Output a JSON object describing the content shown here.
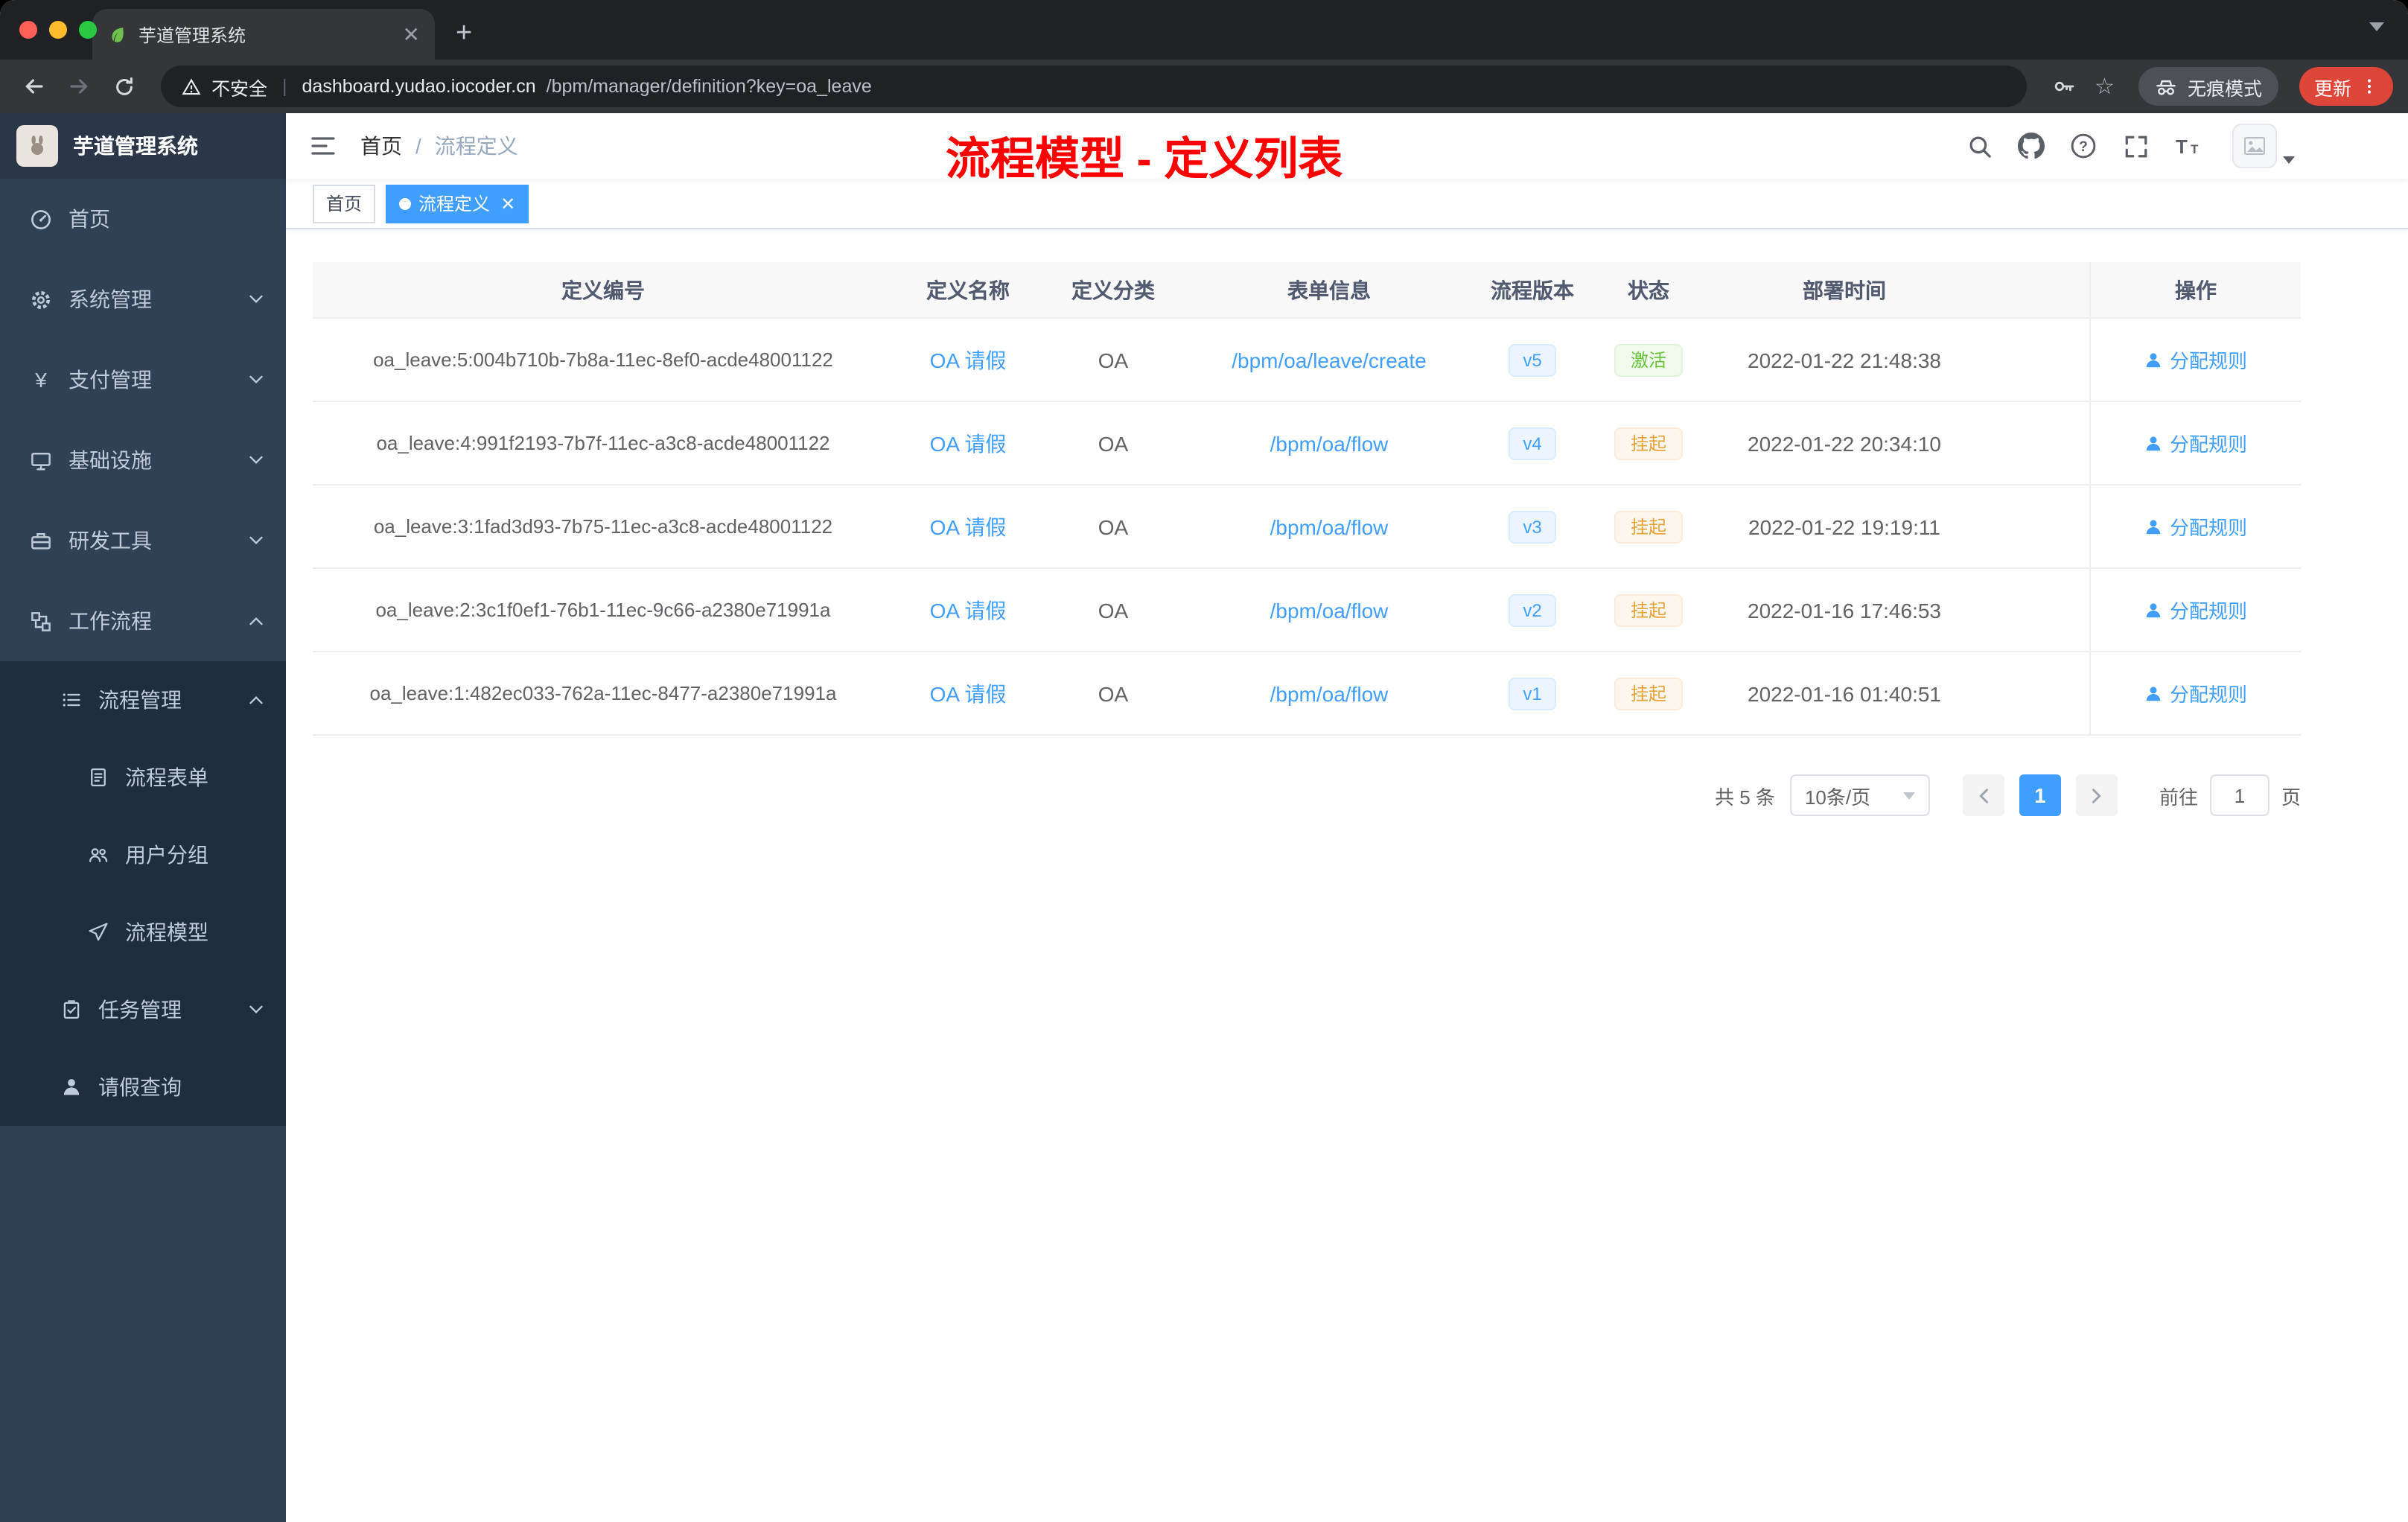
{
  "browser": {
    "tab_title": "芋道管理系统",
    "security_label": "不安全",
    "url_host": "dashboard.yudao.iocoder.cn",
    "url_path": "/bpm/manager/definition?key=oa_leave",
    "incognito_label": "无痕模式",
    "update_label": "更新"
  },
  "sidebar": {
    "logo_title": "芋道管理系统",
    "menu": [
      {
        "label": "首页"
      },
      {
        "label": "系统管理"
      },
      {
        "label": "支付管理"
      },
      {
        "label": "基础设施"
      },
      {
        "label": "研发工具"
      },
      {
        "label": "工作流程"
      }
    ],
    "submenu": [
      {
        "label": "流程管理"
      },
      {
        "label": "流程表单"
      },
      {
        "label": "用户分组"
      },
      {
        "label": "流程模型"
      },
      {
        "label": "任务管理"
      },
      {
        "label": "请假查询"
      }
    ]
  },
  "header": {
    "breadcrumb": [
      "首页",
      "流程定义"
    ],
    "breadcrumb_sep": "/",
    "annotation": "流程模型 - 定义列表"
  },
  "tags": [
    {
      "label": "首页",
      "active": false
    },
    {
      "label": "流程定义",
      "active": true
    }
  ],
  "table": {
    "headers": [
      "定义编号",
      "定义名称",
      "定义分类",
      "表单信息",
      "流程版本",
      "状态",
      "部署时间",
      "操作"
    ],
    "rows": [
      {
        "id": "oa_leave:5:004b710b-7b8a-11ec-8ef0-acde48001122",
        "name": "OA 请假",
        "category": "OA",
        "form": "/bpm/oa/leave/create",
        "version": "v5",
        "status": "激活",
        "status_type": "success",
        "time": "2022-01-22 21:48:38",
        "action": "分配规则"
      },
      {
        "id": "oa_leave:4:991f2193-7b7f-11ec-a3c8-acde48001122",
        "name": "OA 请假",
        "category": "OA",
        "form": "/bpm/oa/flow",
        "version": "v4",
        "status": "挂起",
        "status_type": "warning",
        "time": "2022-01-22 20:34:10",
        "action": "分配规则"
      },
      {
        "id": "oa_leave:3:1fad3d93-7b75-11ec-a3c8-acde48001122",
        "name": "OA 请假",
        "category": "OA",
        "form": "/bpm/oa/flow",
        "version": "v3",
        "status": "挂起",
        "status_type": "warning",
        "time": "2022-01-22 19:19:11",
        "action": "分配规则"
      },
      {
        "id": "oa_leave:2:3c1f0ef1-76b1-11ec-9c66-a2380e71991a",
        "name": "OA 请假",
        "category": "OA",
        "form": "/bpm/oa/flow",
        "version": "v2",
        "status": "挂起",
        "status_type": "warning",
        "time": "2022-01-16 17:46:53",
        "action": "分配规则"
      },
      {
        "id": "oa_leave:1:482ec033-762a-11ec-8477-a2380e71991a",
        "name": "OA 请假",
        "category": "OA",
        "form": "/bpm/oa/flow",
        "version": "v1",
        "status": "挂起",
        "status_type": "warning",
        "time": "2022-01-16 01:40:51",
        "action": "分配规则"
      }
    ]
  },
  "pagination": {
    "total": "共 5 条",
    "page_size": "10条/页",
    "page": "1",
    "goto_prefix": "前往",
    "goto_value": "1",
    "goto_suffix": "页"
  },
  "colors": {
    "accent": "#409eff",
    "success": "#67c23a",
    "warning": "#e6a23c",
    "annotation_red": "#fe0000",
    "sidebar_bg": "#304156",
    "submenu_bg": "#1f2d3d",
    "active_tag_bg": "#409eff"
  }
}
